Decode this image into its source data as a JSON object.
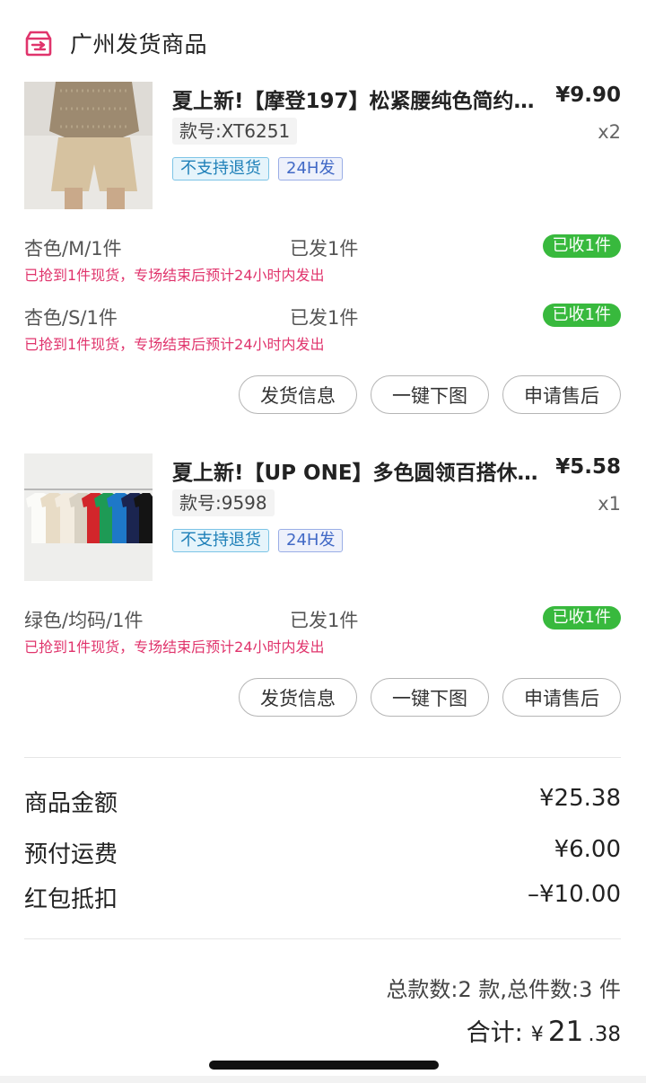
{
  "header": {
    "title": "广州发货商品",
    "icon": "shipment-box-icon",
    "accent": "#e0346c"
  },
  "products": [
    {
      "title": "夏上新!【摩登197】松紧腰纯色简约…",
      "price": "¥9.90",
      "code": "款号:XT6251",
      "qty": "x2",
      "tags": [
        "不支持退货",
        "24H发"
      ],
      "variants": [
        {
          "spec": "杏色/M/1件",
          "sent": "已发1件",
          "badge": "已收1件",
          "note": "已抢到1件现货，专场结束后预计24小时内发出"
        },
        {
          "spec": "杏色/S/1件",
          "sent": "已发1件",
          "badge": "已收1件",
          "note": "已抢到1件现货，专场结束后预计24小时内发出"
        }
      ],
      "actions": [
        "发货信息",
        "一键下图",
        "申请售后"
      ]
    },
    {
      "title": "夏上新!【UP ONE】多色圆领百搭休…",
      "price": "¥5.58",
      "code": "款号:9598",
      "qty": "x1",
      "tags": [
        "不支持退货",
        "24H发"
      ],
      "variants": [
        {
          "spec": "绿色/均码/1件",
          "sent": "已发1件",
          "badge": "已收1件",
          "note": "已抢到1件现货，专场结束后预计24小时内发出"
        }
      ],
      "actions": [
        "发货信息",
        "一键下图",
        "申请售后"
      ]
    }
  ],
  "summary": {
    "goods_label": "商品金额",
    "goods_value": "¥25.38",
    "shipping_label": "预付运费",
    "shipping_value": "¥6.00",
    "coupon_label": "红包抵扣",
    "coupon_value": "–¥10.00"
  },
  "counts": "总款数:2 款,总件数:3 件",
  "total": {
    "label": "合计:",
    "currency": "¥",
    "integer": "21",
    "decimal": ".38"
  },
  "colors": {
    "received_badge": "#38b93d",
    "note_text": "#e0346c",
    "tag_cyan": "#1d7fb8",
    "tag_blue": "#4169c6"
  }
}
